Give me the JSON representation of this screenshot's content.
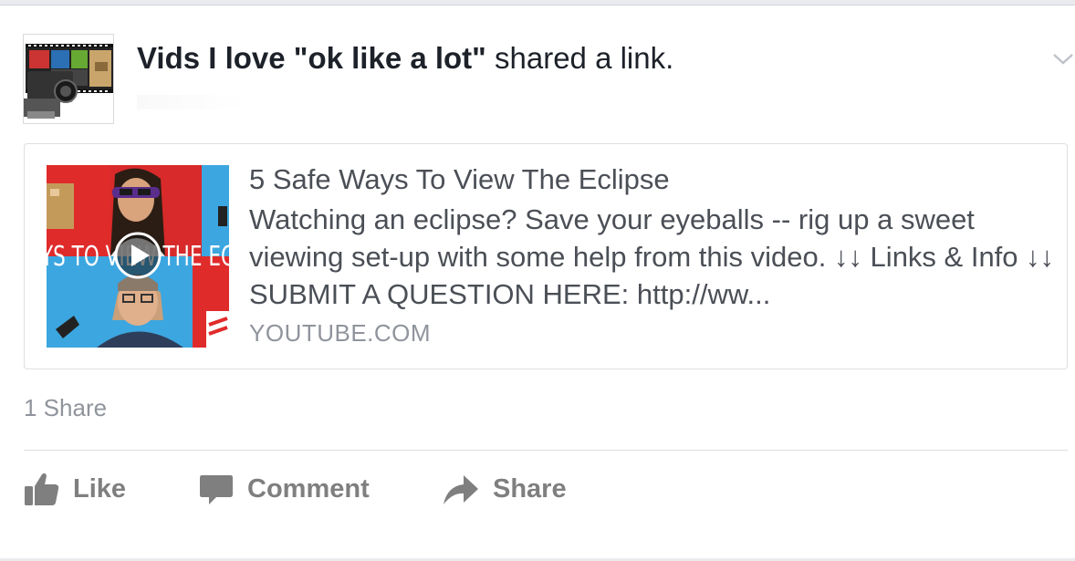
{
  "post": {
    "author": "Vids I love \"ok like a lot\"",
    "action": " shared a link."
  },
  "link": {
    "title": "5 Safe Ways To View The Eclipse",
    "description": "Watching an eclipse? Save your eyeballs -- rig up a sweet viewing set-up with some help from this video. ↓↓ Links & Info ↓↓ SUBMIT A QUESTION HERE: http://ww...",
    "domain": "YOUTUBE.COM",
    "thumbnail_banner": "YS TO VIEW THE EC"
  },
  "stats": {
    "shares": "1 Share"
  },
  "actions": {
    "like": "Like",
    "comment": "Comment",
    "share": "Share"
  },
  "colors": {
    "text": "#1d2129",
    "muted": "#90949c",
    "action": "#7f7f7f",
    "border": "#dddfe2"
  }
}
